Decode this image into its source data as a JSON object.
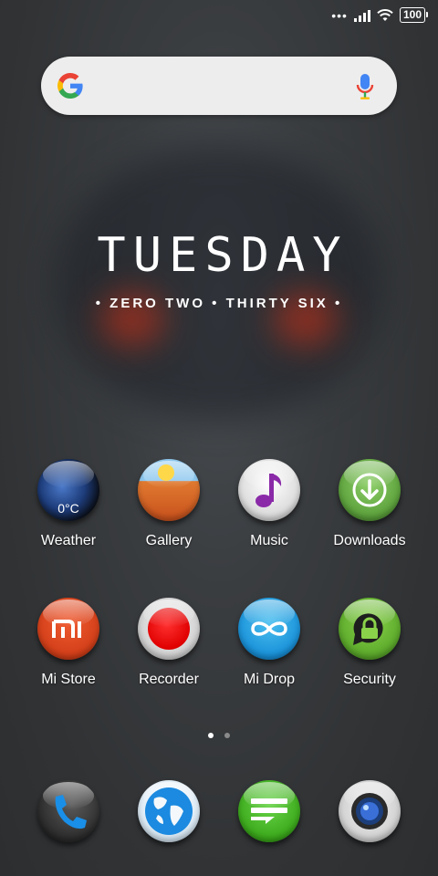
{
  "status_bar": {
    "battery_level": "100"
  },
  "search": {
    "mic_icon": "mic-icon",
    "logo_icon": "google-g-icon"
  },
  "clock_widget": {
    "day": "TUESDAY",
    "time_text": "• ZERO TWO • THIRTY SIX •"
  },
  "apps": {
    "weather": {
      "label": "Weather",
      "temp": "0°C"
    },
    "gallery": {
      "label": "Gallery"
    },
    "music": {
      "label": "Music"
    },
    "downloads": {
      "label": "Downloads"
    },
    "mistore": {
      "label": "Mi Store"
    },
    "recorder": {
      "label": "Recorder"
    },
    "midrop": {
      "label": "Mi Drop"
    },
    "security": {
      "label": "Security"
    }
  },
  "page_indicator": {
    "pages": 2,
    "current": 1
  },
  "dock": [
    "phone-icon",
    "browser-icon",
    "messages-icon",
    "camera-icon"
  ],
  "colors": {
    "background": "#323436",
    "search_bar": "#ededed",
    "accent_red": "#e00000",
    "accent_green": "#5a9f3a",
    "accent_blue": "#1890d8"
  }
}
